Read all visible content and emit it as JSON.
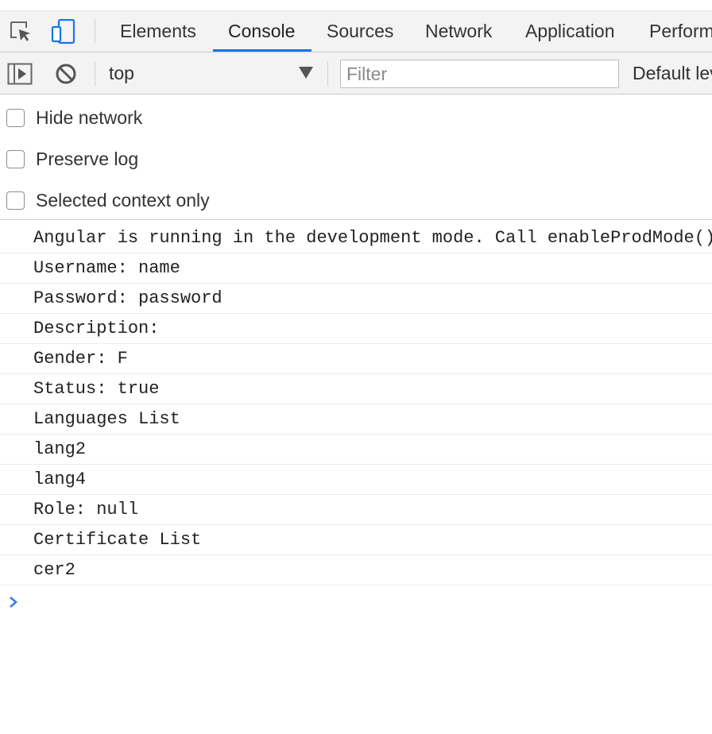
{
  "tabs": [
    {
      "label": "Elements",
      "active": false
    },
    {
      "label": "Console",
      "active": true
    },
    {
      "label": "Sources",
      "active": false
    },
    {
      "label": "Network",
      "active": false
    },
    {
      "label": "Application",
      "active": false
    },
    {
      "label": "Perform",
      "active": false
    }
  ],
  "toolbar": {
    "context": "top",
    "filter_placeholder": "Filter",
    "levels": "Default lev"
  },
  "settings": [
    {
      "label": "Hide network",
      "checked": false
    },
    {
      "label": "Preserve log",
      "checked": false
    },
    {
      "label": "Selected context only",
      "checked": false
    }
  ],
  "messages": [
    "Angular is running in the development mode. Call enableProdMode()",
    "Username: name",
    "Password: password",
    "Description:",
    "Gender: F",
    "Status: true",
    "Languages List",
    "lang2",
    "lang4",
    "Role: null",
    "Certificate List",
    "cer2"
  ],
  "icons": {
    "inspect": "inspect-element-icon",
    "device": "device-toolbar-icon",
    "sidebar": "show-sidebar-icon",
    "clear": "clear-console-icon",
    "context_dropdown": "dropdown-arrow-icon",
    "prompt": "chevron-right-icon"
  },
  "colors": {
    "accent": "#1a73e8",
    "panel_bg": "#f3f3f3",
    "prompt": "#3b7ee8"
  }
}
